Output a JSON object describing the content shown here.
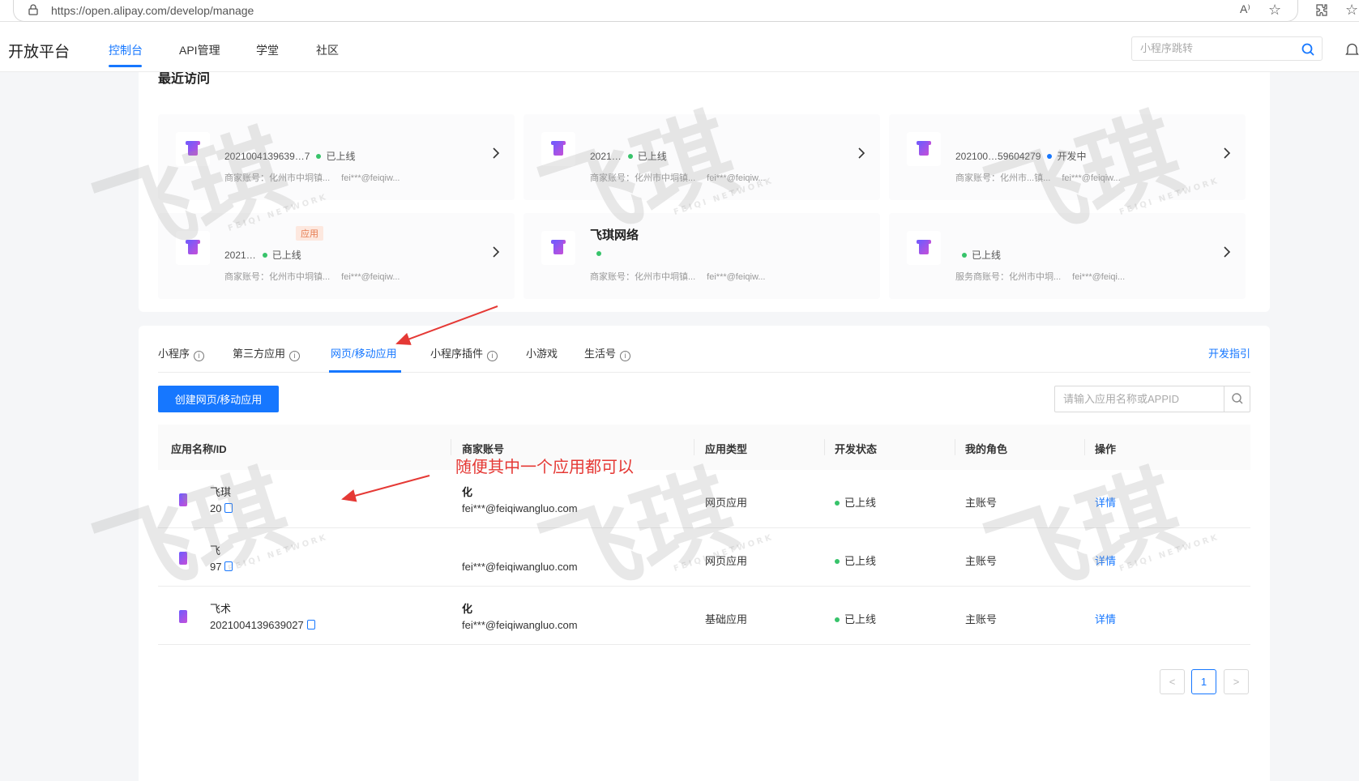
{
  "browser": {
    "url": "https://open.alipay.com/develop/manage"
  },
  "header": {
    "brand": "开放平台",
    "nav": [
      {
        "label": "控制台",
        "active": true
      },
      {
        "label": "API管理",
        "active": false
      },
      {
        "label": "学堂",
        "active": false
      },
      {
        "label": "社区",
        "active": false
      }
    ],
    "search_placeholder": "小程序跳转"
  },
  "recent": {
    "title": "最近访问",
    "tiles": [
      {
        "name": "",
        "tag": "",
        "id": "2021004139639…7",
        "status": "已上线",
        "status_color": "green",
        "account_label": "商家账号：化州市中垌镇...",
        "email": "fei***@feiqiw..."
      },
      {
        "name": "",
        "tag": "",
        "id": "2021…",
        "status": "已上线",
        "status_color": "green",
        "account_label": "商家账号：化州市中垌镇...",
        "email": "fei***@feiqiw..."
      },
      {
        "name": "",
        "tag": "",
        "id": "202100…59604279",
        "status": "开发中",
        "status_color": "blue",
        "account_label": "商家账号：化州市...镇...",
        "email": "fei***@feiqiw..."
      },
      {
        "name": "",
        "tag": "应用",
        "id": "2021…",
        "status": "已上线",
        "status_color": "green",
        "account_label": "商家账号：化州市中垌镇...",
        "email": "fei***@feiqiw..."
      },
      {
        "name": "飞琪网络",
        "tag": "",
        "id": "",
        "status": "",
        "status_color": "green",
        "account_label": "商家账号：化州市中垌镇...",
        "email": "fei***@feiqiw..."
      },
      {
        "name": "",
        "tag": "",
        "id": "",
        "status": "已上线",
        "status_color": "green",
        "account_label": "服务商账号：化州市中垌...",
        "email": "fei***@feiqi..."
      }
    ]
  },
  "apps": {
    "tabs": [
      {
        "label": "小程序",
        "info": true,
        "active": false
      },
      {
        "label": "第三方应用",
        "info": true,
        "active": false
      },
      {
        "label": "网页/移动应用",
        "info": false,
        "active": true
      },
      {
        "label": "小程序插件",
        "info": true,
        "active": false
      },
      {
        "label": "小游戏",
        "info": false,
        "active": false
      },
      {
        "label": "生活号",
        "info": true,
        "active": false
      }
    ],
    "guide_link": "开发指引",
    "create_button": "创建网页/移动应用",
    "search_placeholder": "请输入应用名称或APPID",
    "columns": [
      "应用名称/ID",
      "商家账号",
      "应用类型",
      "开发状态",
      "我的角色",
      "操作"
    ],
    "rows": [
      {
        "name": "飞琪",
        "id": "20",
        "merchant": "化",
        "email": "fei***@feiqiwangluo.com",
        "type": "网页应用",
        "status": "已上线",
        "role": "主账号",
        "action": "详情"
      },
      {
        "name": "飞",
        "id": "97",
        "merchant": "",
        "email": "fei***@feiqiwangluo.com",
        "type": "网页应用",
        "status": "已上线",
        "role": "主账号",
        "action": "详情"
      },
      {
        "name": "飞术",
        "id": "2021004139639027",
        "merchant": "化",
        "email": "fei***@feiqiwangluo.com",
        "type": "基础应用",
        "status": "已上线",
        "role": "主账号",
        "action": "详情"
      }
    ],
    "pagination": {
      "prev": "<",
      "current": "1",
      "next": ">"
    }
  },
  "annotation": {
    "text": "随便其中一个应用都可以",
    "color": "#e53935"
  },
  "watermark": {
    "text": "飞琪",
    "subtext": "FEIQI NETWORK"
  },
  "colors": {
    "primary": "#1677ff",
    "online": "#37c36a",
    "developing": "#1677ff"
  }
}
